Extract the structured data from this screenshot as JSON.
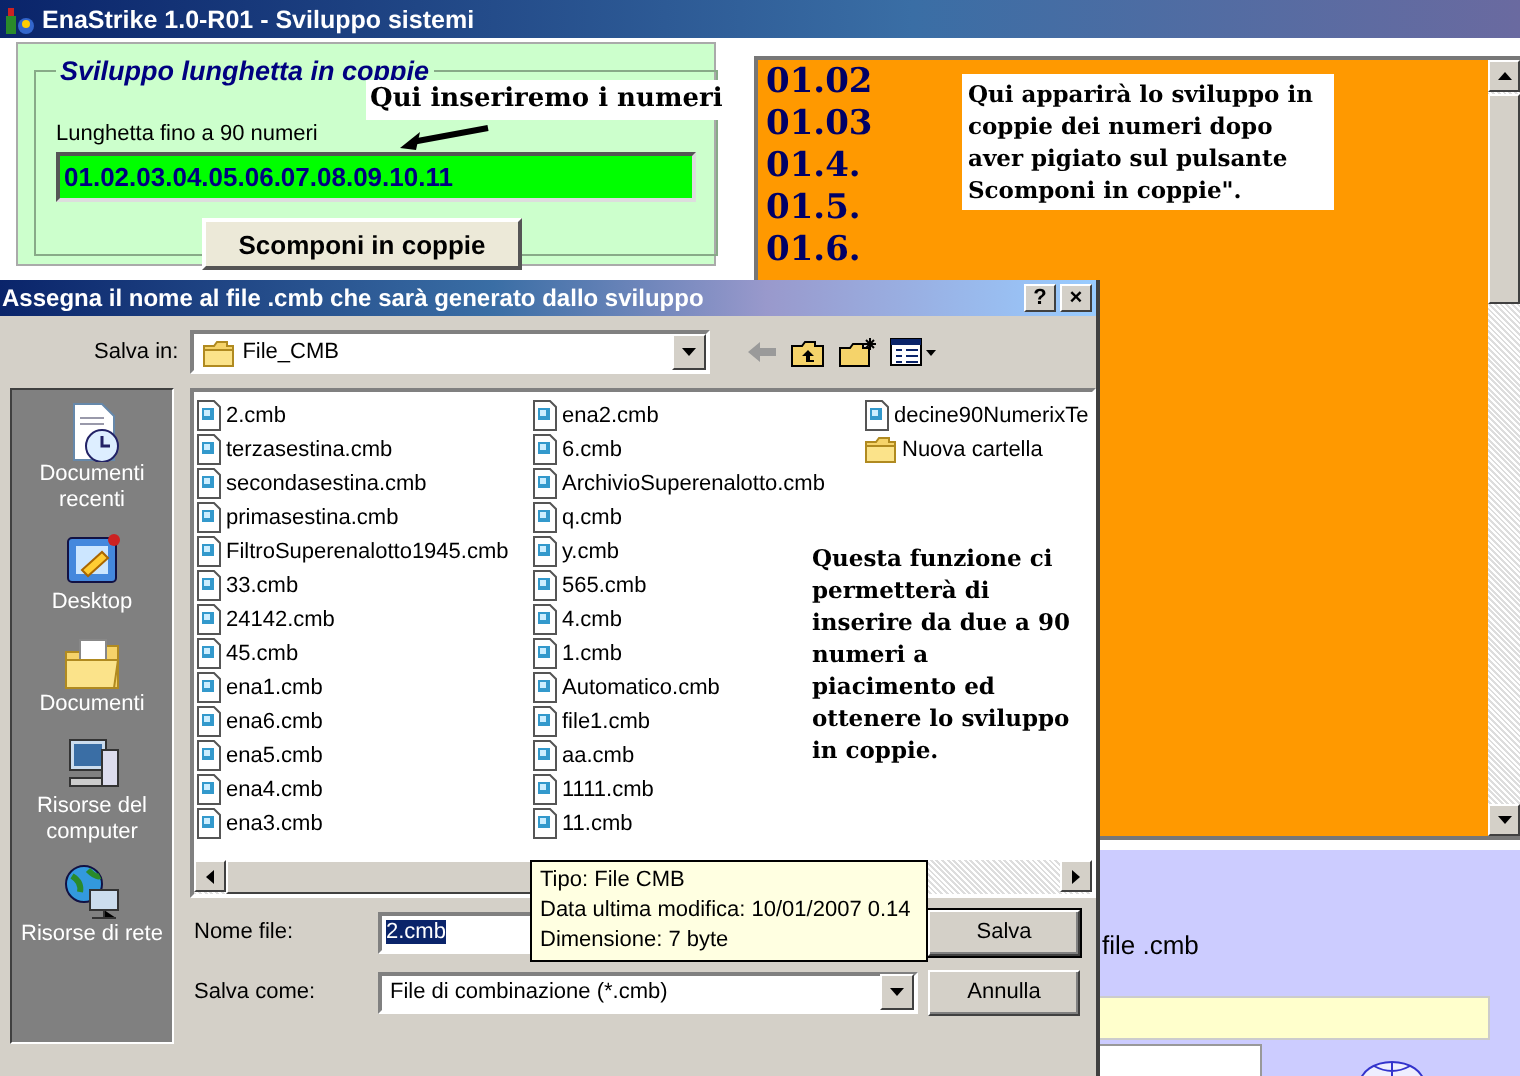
{
  "window": {
    "title": "EnaStrike 1.0-R01 - Sviluppo sistemi"
  },
  "group": {
    "title": "Sviluppo lunghetta in coppie",
    "field_label": "Lunghetta fino a 90 numeri",
    "field_value": "01.02.03.04.05.06.07.08.09.10.11",
    "button": "Scomponi in coppie"
  },
  "pairs_list": {
    "items": [
      "01.02",
      "01.03",
      "01.4.",
      "01.5.",
      "01.6."
    ]
  },
  "lower_panel": {
    "label": "file .cmb"
  },
  "annotations": [
    {
      "kind": "input_note",
      "text": "Qui inseriremo i numeri"
    },
    {
      "kind": "list_note",
      "text": "Qui apparirà lo sviluppo in coppie dei numeri dopo aver pigiato sul pulsante Scomponi in coppie\"."
    },
    {
      "kind": "dialog_note",
      "text": "Questa funzione ci permetterà di inserire da due a 90 numeri a piacimento ed ottenere lo sviluppo in coppie."
    }
  ],
  "dialog": {
    "title": "Assegna il nome al file .cmb che sarà generato dallo sviluppo",
    "title_buttons": [
      "?",
      "×"
    ],
    "save_in_label": "Salva in:",
    "folder": "File_CMB",
    "places": [
      {
        "kind": "recent",
        "label": "Documenti recenti"
      },
      {
        "kind": "desktop",
        "label": "Desktop"
      },
      {
        "kind": "documents",
        "label": "Documenti"
      },
      {
        "kind": "computer",
        "label": "Risorse del computer"
      },
      {
        "kind": "network",
        "label": "Risorse di rete"
      }
    ],
    "files": [
      {
        "kind": "file",
        "name": "2.cmb"
      },
      {
        "kind": "file",
        "name": "terzasestina.cmb"
      },
      {
        "kind": "file",
        "name": "secondasestina.cmb"
      },
      {
        "kind": "file",
        "name": "primasestina.cmb"
      },
      {
        "kind": "file",
        "name": "FiltroSuperenalotto1945.cmb"
      },
      {
        "kind": "file",
        "name": "33.cmb"
      },
      {
        "kind": "file",
        "name": "24142.cmb"
      },
      {
        "kind": "file",
        "name": "45.cmb"
      },
      {
        "kind": "file",
        "name": "ena1.cmb"
      },
      {
        "kind": "file",
        "name": "ena6.cmb"
      },
      {
        "kind": "file",
        "name": "ena5.cmb"
      },
      {
        "kind": "file",
        "name": "ena4.cmb"
      },
      {
        "kind": "file",
        "name": "ena3.cmb"
      },
      {
        "kind": "file",
        "name": "ena2.cmb"
      },
      {
        "kind": "file",
        "name": "6.cmb"
      },
      {
        "kind": "file",
        "name": "ArchivioSuperenalotto.cmb"
      },
      {
        "kind": "file",
        "name": "q.cmb"
      },
      {
        "kind": "file",
        "name": "y.cmb"
      },
      {
        "kind": "file",
        "name": "565.cmb"
      },
      {
        "kind": "file",
        "name": "4.cmb"
      },
      {
        "kind": "file",
        "name": "1.cmb"
      },
      {
        "kind": "file",
        "name": "Automatico.cmb"
      },
      {
        "kind": "file",
        "name": "file1.cmb"
      },
      {
        "kind": "file",
        "name": "aa.cmb"
      },
      {
        "kind": "file",
        "name": "1111.cmb"
      },
      {
        "kind": "file",
        "name": "11.cmb"
      },
      {
        "kind": "file",
        "name": "decine90NumerixTe"
      },
      {
        "kind": "folder",
        "name": "Nuova cartella"
      }
    ],
    "tooltip": [
      "Tipo: File CMB",
      "Data ultima modifica: 10/01/2007 0.14",
      "Dimensione: 7 byte"
    ],
    "filename_label": "Nome file:",
    "filename_value": "2.cmb",
    "type_label": "Salva come:",
    "type_value": "File di combinazione (*.cmb)",
    "buttons": [
      "Salva",
      "Annulla"
    ]
  }
}
